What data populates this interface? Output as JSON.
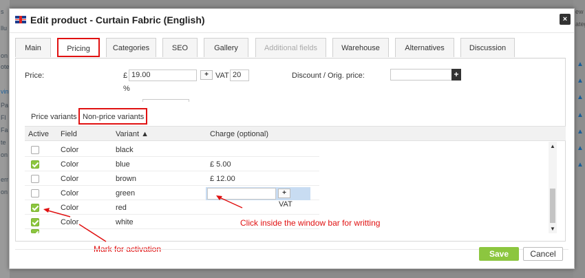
{
  "background": {
    "left_fragments": [
      "s",
      "llu",
      "on",
      "ote",
      "vin",
      "Pa",
      "Fl",
      "Fa",
      "te",
      "on",
      "err",
      "on"
    ],
    "right_fragments": [
      "ew",
      "ateg"
    ]
  },
  "dialog": {
    "title": "Edit product - Curtain Fabric (English)",
    "close_label": "×",
    "flag": "uk-flag-icon"
  },
  "tabs": [
    {
      "label": "Main"
    },
    {
      "label": "Pricing",
      "active": true
    },
    {
      "label": "Categories"
    },
    {
      "label": "SEO"
    },
    {
      "label": "Gallery"
    },
    {
      "label": "Additional fields",
      "disabled": true
    },
    {
      "label": "Warehouse"
    },
    {
      "label": "Alternatives"
    },
    {
      "label": "Discussion"
    }
  ],
  "pricing": {
    "price_label": "Price:",
    "currency": "£",
    "price_value": "19.00",
    "plus_label": "+",
    "vat_label": "VAT",
    "vat_value": "20",
    "percent": "%",
    "discount_label": "Discount / Orig. price:",
    "discount_value": ""
  },
  "subtabs": {
    "price_variants": "Price variants",
    "non_price_variants": "Non-price variants"
  },
  "grid": {
    "headers": {
      "active": "Active",
      "field": "Field",
      "variant": "Variant ▲",
      "charge": "Charge (optional)"
    },
    "rows": [
      {
        "active": false,
        "field": "Color",
        "variant": "black",
        "charge": ""
      },
      {
        "active": true,
        "field": "Color",
        "variant": "blue",
        "charge": "£ 5.00"
      },
      {
        "active": false,
        "field": "Color",
        "variant": "brown",
        "charge": "£ 12.00"
      },
      {
        "active": false,
        "field": "Color",
        "variant": "green",
        "charge": ""
      },
      {
        "active": true,
        "field": "Color",
        "variant": "red",
        "charge": ""
      },
      {
        "active": true,
        "field": "Color",
        "variant": "white",
        "charge": ""
      }
    ],
    "edit_plus": "+",
    "edit_vat": "VAT"
  },
  "annotations": {
    "window_bar": "Click inside the window bar for writting",
    "activation": "Mark for activation"
  },
  "footer": {
    "save": "Save",
    "cancel": "Cancel"
  },
  "colors": {
    "accent_green": "#8cc63f",
    "annotation_red": "#e01010"
  }
}
